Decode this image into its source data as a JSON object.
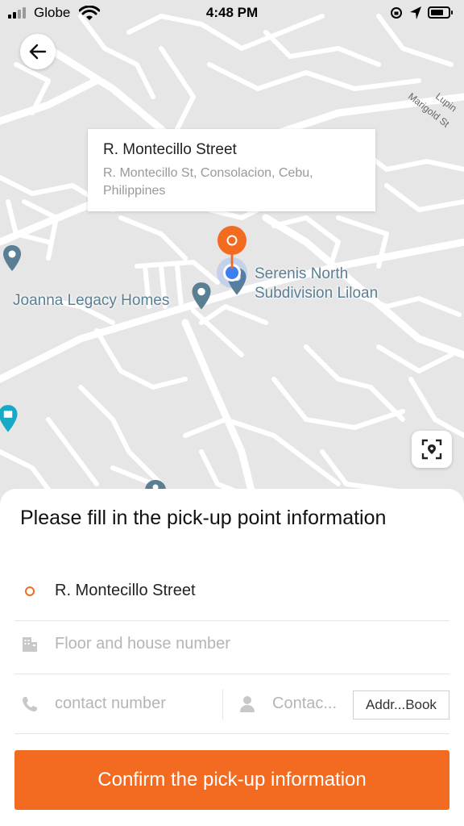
{
  "status_bar": {
    "carrier": "Globe",
    "time": "4:48 PM"
  },
  "map": {
    "callout": {
      "title": "R. Montecillo Street",
      "address": "R. Montecillo St, Consolacion, Cebu, Philippines"
    },
    "labels": {
      "serenis": "Serenis North Subdivision Liloan",
      "joanna": "Joanna Legacy Homes",
      "marigold": "Marigold St",
      "lupin": "Lupin"
    },
    "colors": {
      "pin": "#f26b21",
      "user_location": "#3d7ef0",
      "poi": "#5a7f93",
      "poi_alt": "#18a9c6"
    }
  },
  "form": {
    "title": "Please fill in the pick-up point information",
    "address": "R. Montecillo Street",
    "floor_placeholder": "Floor and house number",
    "contact_number_placeholder": "contact number",
    "contact_name_placeholder": "Contac...",
    "address_book_label": "Addr...Book",
    "confirm_label": "Confirm the pick-up information"
  },
  "icons": {
    "back": "arrow-left-icon",
    "locate": "locate-icon",
    "address": "circle-icon",
    "floor": "building-icon",
    "phone": "phone-icon",
    "person": "person-icon"
  },
  "accent_color": "#f26b21"
}
